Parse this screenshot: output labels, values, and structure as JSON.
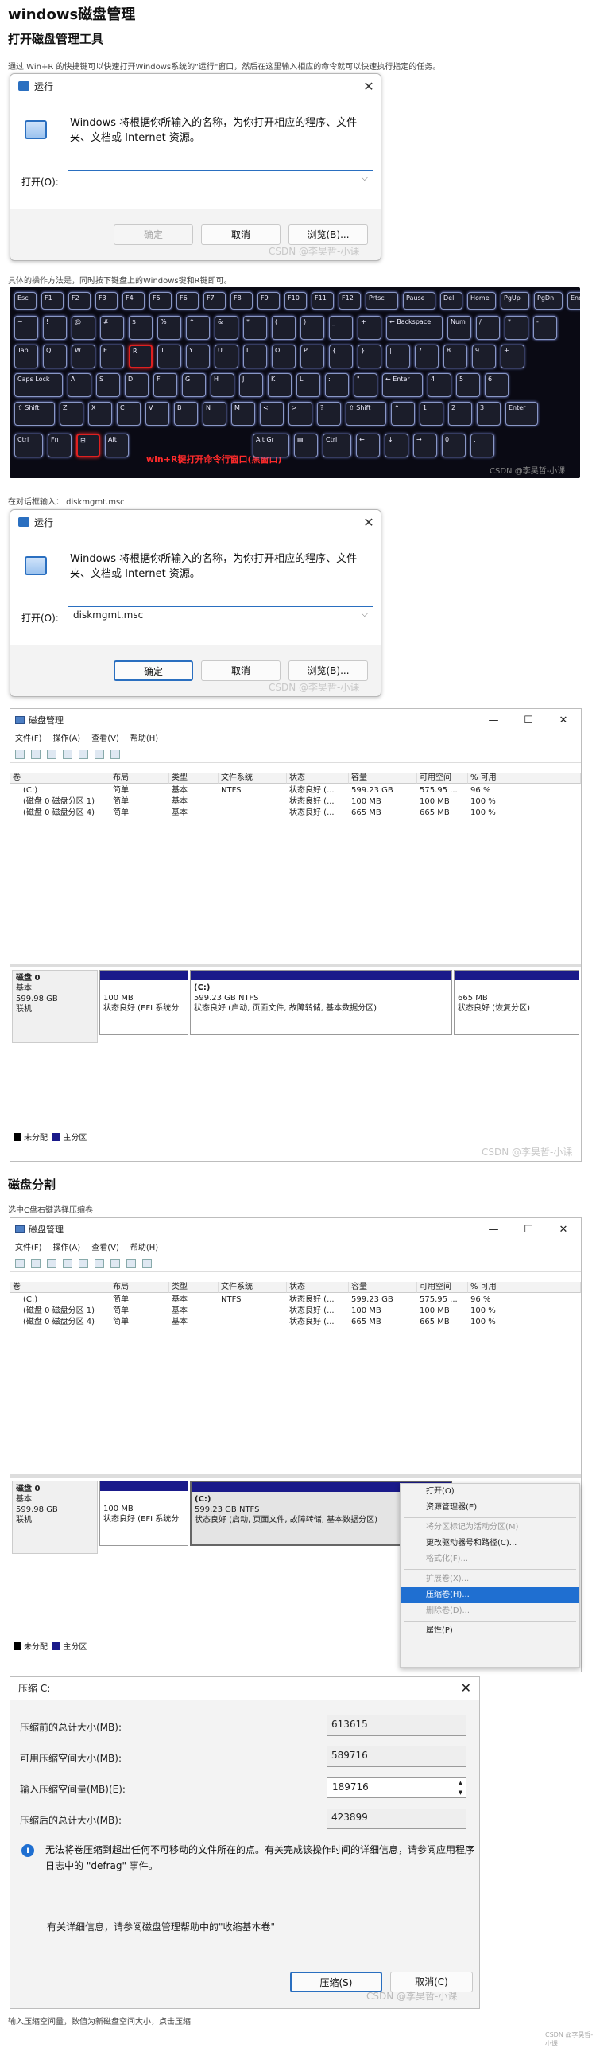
{
  "title": "windows磁盘管理",
  "section1": {
    "heading": "打开磁盘管理工具",
    "intro": "通过 Win+R 的快捷键可以快速打开Windows系统的\"运行\"窗口，然后在这里输入相应的命令就可以快速执行指定的任务。",
    "caption_keys": "具体的操作方法是，同时按下键盘上的Windows键和R键即可。",
    "caption_input": "在对话框输入： diskmgmt.msc"
  },
  "run_dialog": {
    "title": "运行",
    "description": "Windows 将根据你所输入的名称，为你打开相应的程序、文件夹、文档或 Internet 资源。",
    "open_label": "打开(O):",
    "ok": "确定",
    "cancel": "取消",
    "browse": "浏览(B)...",
    "input_empty": "",
    "input_filled": "diskmgmt.msc"
  },
  "watermark": "CSDN @李昊哲-小课",
  "keyboard": {
    "note": "win+R键打开命令行窗口(黑窗口)",
    "row1": [
      "Esc",
      "F1",
      "F2",
      "F3",
      "F4",
      "F5",
      "F6",
      "F7",
      "F8",
      "F9",
      "F10",
      "F11",
      "F12",
      "Prtsc",
      "Pause",
      "Del",
      "Home",
      "PgUp",
      "PgDn",
      "End"
    ],
    "row2": [
      "~",
      "!",
      "@",
      "#",
      "$",
      "%",
      "^",
      "&",
      "*",
      "(",
      ")",
      "_",
      "+",
      "← Backspace",
      "Num",
      "/",
      "*",
      "-"
    ],
    "row3": [
      "Tab",
      "Q",
      "W",
      "E",
      "R",
      "T",
      "Y",
      "U",
      "I",
      "O",
      "P",
      "{",
      "}",
      "|",
      "7",
      "8",
      "9",
      "+"
    ],
    "row4": [
      "Caps Lock",
      "A",
      "S",
      "D",
      "F",
      "G",
      "H",
      "J",
      "K",
      "L",
      ":",
      "\"",
      "← Enter",
      "4",
      "5",
      "6"
    ],
    "row5": [
      "⇧ Shift",
      "Z",
      "X",
      "C",
      "V",
      "B",
      "N",
      "M",
      "<",
      ">",
      "?",
      "⇧ Shift",
      "↑",
      "1",
      "2",
      "3",
      "Enter"
    ],
    "row6": [
      "Ctrl",
      "Fn",
      "⊞",
      "Alt",
      "Alt Gr",
      "▤",
      "Ctrl",
      "←",
      "↓",
      "→",
      "0",
      "."
    ]
  },
  "disk_mgmt": {
    "title": "磁盘管理",
    "menu": [
      "文件(F)",
      "操作(A)",
      "查看(V)",
      "帮助(H)"
    ],
    "columns": [
      "卷",
      "布局",
      "类型",
      "文件系统",
      "状态",
      "容量",
      "可用空间",
      "% 可用"
    ],
    "rows": [
      [
        "(C:)",
        "简单",
        "基本",
        "NTFS",
        "状态良好 (...",
        "599.23 GB",
        "575.95 ...",
        "96 %"
      ],
      [
        "(磁盘 0 磁盘分区 1)",
        "简单",
        "基本",
        "",
        "状态良好 (...",
        "100 MB",
        "100 MB",
        "100 %"
      ],
      [
        "(磁盘 0 磁盘分区 4)",
        "简单",
        "基本",
        "",
        "状态良好 (...",
        "665 MB",
        "665 MB",
        "100 %"
      ]
    ],
    "disk": {
      "name": "磁盘 0",
      "type": "基本",
      "size": "599.98 GB",
      "status": "联机"
    },
    "partitions": [
      {
        "title": "",
        "size": "100 MB",
        "status": "状态良好 (EFI 系统分"
      },
      {
        "title": "(C:)",
        "size": "599.23 GB NTFS",
        "status": "状态良好 (启动, 页面文件, 故障转储, 基本数据分区)"
      },
      {
        "title": "",
        "size": "665 MB",
        "status": "状态良好 (恢复分区)"
      }
    ],
    "legend": [
      "未分配",
      "主分区"
    ]
  },
  "section2": {
    "heading": "磁盘分割",
    "caption": "选中C盘右键选择压缩卷",
    "footer": "输入压缩空间量，数值为新磁盘空间大小，点击压缩"
  },
  "context_menu": {
    "items": [
      {
        "label": "打开(O)",
        "enabled": true
      },
      {
        "label": "资源管理器(E)",
        "enabled": true
      },
      {
        "label": "将分区标记为活动分区(M)",
        "enabled": false
      },
      {
        "label": "更改驱动器号和路径(C)...",
        "enabled": true
      },
      {
        "label": "格式化(F)...",
        "enabled": false
      },
      {
        "label": "扩展卷(X)...",
        "enabled": false
      },
      {
        "label": "压缩卷(H)...",
        "enabled": true,
        "selected": true
      },
      {
        "label": "删除卷(D)...",
        "enabled": false
      },
      {
        "label": "属性(P)",
        "enabled": true
      }
    ]
  },
  "shrink_dialog": {
    "title": "压缩 C:",
    "rows": [
      {
        "label": "压缩前的总计大小(MB):",
        "value": "613615"
      },
      {
        "label": "可用压缩空间大小(MB):",
        "value": "589716"
      },
      {
        "label": "输入压缩空间量(MB)(E):",
        "value": "189716"
      },
      {
        "label": "压缩后的总计大小(MB):",
        "value": "423899"
      }
    ],
    "info": "无法将卷压缩到超出任何不可移动的文件所在的点。有关完成该操作时间的详细信息，请参阅应用程序日志中的 \"defrag\" 事件。",
    "help": "有关详细信息，请参阅磁盘管理帮助中的\"收缩基本卷\"",
    "shrink_btn": "压缩(S)",
    "cancel_btn": "取消(C)"
  },
  "colors": {
    "accent": "#2a6fc0",
    "primary_partition": "#1a1a8a",
    "unallocated": "#000000",
    "highlight": "#e02020"
  }
}
